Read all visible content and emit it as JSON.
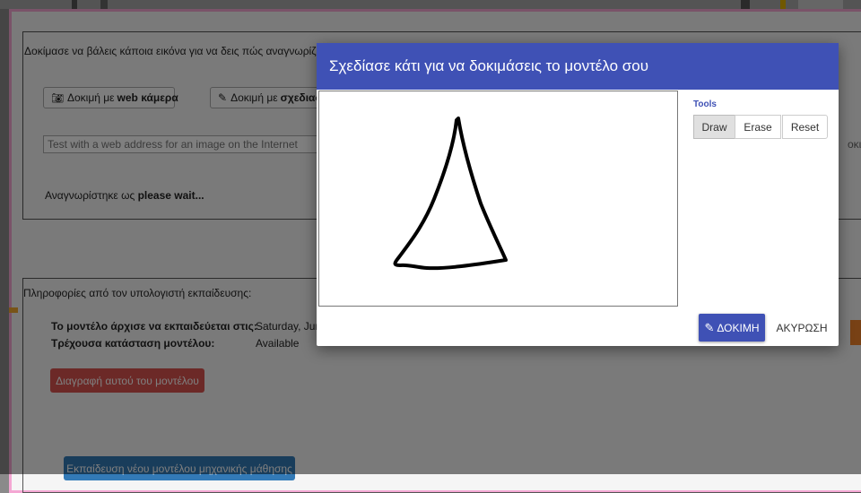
{
  "background": {
    "intro_text": "Δοκίμασε να βάλεις κάποια εικόνα για να δεις πώς αναγνωρίζετ",
    "webcam_prefix": "Δοκιμή με ",
    "webcam_bold": "web κάμερα",
    "draw_prefix": "Δοκιμή με ",
    "draw_bold": "σχεδιασ",
    "url_placeholder": "Test with a web address for an image on the Internet",
    "url_button_partial": "οκιμ",
    "recognized_prefix": "Αναγνωρίστηκε ως ",
    "recognized_value": "please wait...",
    "info_heading": "Πληροφορίες από τον υπολογιστή εκπαίδευσης:",
    "started_label": "Το μοντέλο άρχισε να εκπαιδεύεται στις:",
    "started_value": "Saturday, Jun",
    "status_label": "Τρέχουσα κατάσταση μοντέλου:",
    "status_value": "Available",
    "delete_button": "Διαγραφή αυτού του μοντέλου",
    "train_button": "Εκπαίδευση νέου μοντέλου μηχανικής μάθησης"
  },
  "modal": {
    "title": "Σχεδίασε κάτι για να δοκιμάσεις το μοντέλο σου",
    "tools_label": "Tools",
    "tools": [
      "Draw",
      "Erase",
      "Reset"
    ],
    "active_tool": "Draw",
    "test_button": "ΔΟΚΙΜΗ",
    "cancel_button": "ΑΚΥΡΩΣΗ"
  },
  "colors": {
    "header": "#3f51b5",
    "frame_border": "#f4a7d3",
    "delete": "#d9534f",
    "train": "#337ab7"
  },
  "icons": {
    "webcam": "camera-icon",
    "draw": "pencil-icon",
    "test": "pencil-icon"
  }
}
